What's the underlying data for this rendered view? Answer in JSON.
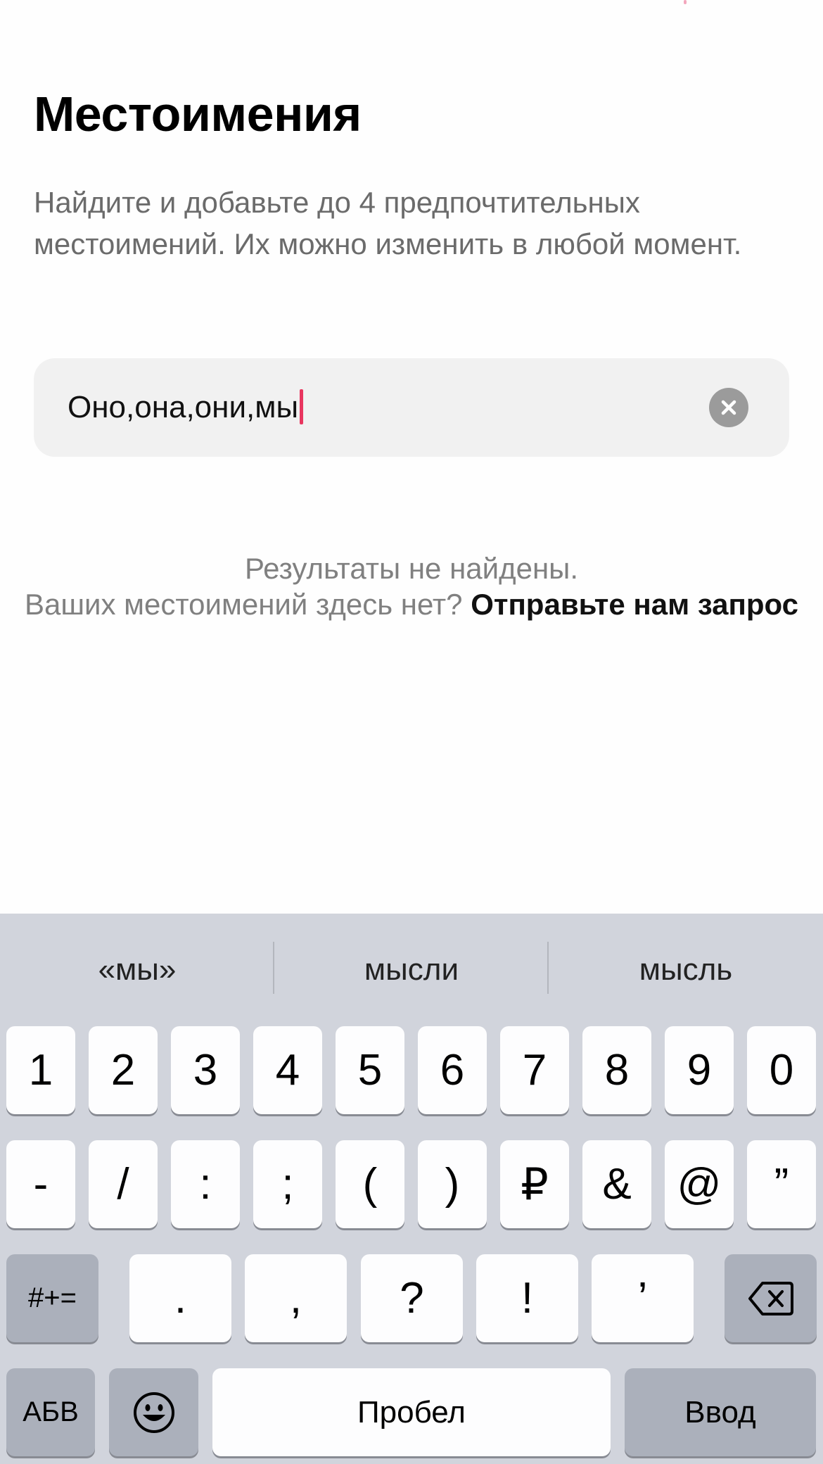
{
  "header": {
    "title": "Местоимения",
    "description": "Найдите и добавьте до 4 предпочтительных местоимений. Их можно изменить в любой момент."
  },
  "search": {
    "value": "Оно,она,они,мы"
  },
  "results": {
    "empty_text": "Результаты не найдены.",
    "prompt_text": "Ваших местоимений здесь нет?",
    "request_link": "Отправьте нам запрос"
  },
  "keyboard": {
    "suggestions": [
      "«мы»",
      "мысли",
      "мысль"
    ],
    "row1": [
      "1",
      "2",
      "3",
      "4",
      "5",
      "6",
      "7",
      "8",
      "9",
      "0"
    ],
    "row2": [
      "-",
      "/",
      ":",
      ";",
      "(",
      ")",
      "₽",
      "&",
      "@",
      "”"
    ],
    "row3": {
      "shift_label": "#+=",
      "keys": [
        ".",
        ",",
        "?",
        "!",
        "’"
      ]
    },
    "row4": {
      "lang_label": "АБВ",
      "space_label": "Пробел",
      "return_label": "Ввод"
    },
    "icons": {
      "clear": "clear-circle-icon",
      "backspace": "backspace-icon",
      "emoji": "emoji-icon"
    }
  }
}
